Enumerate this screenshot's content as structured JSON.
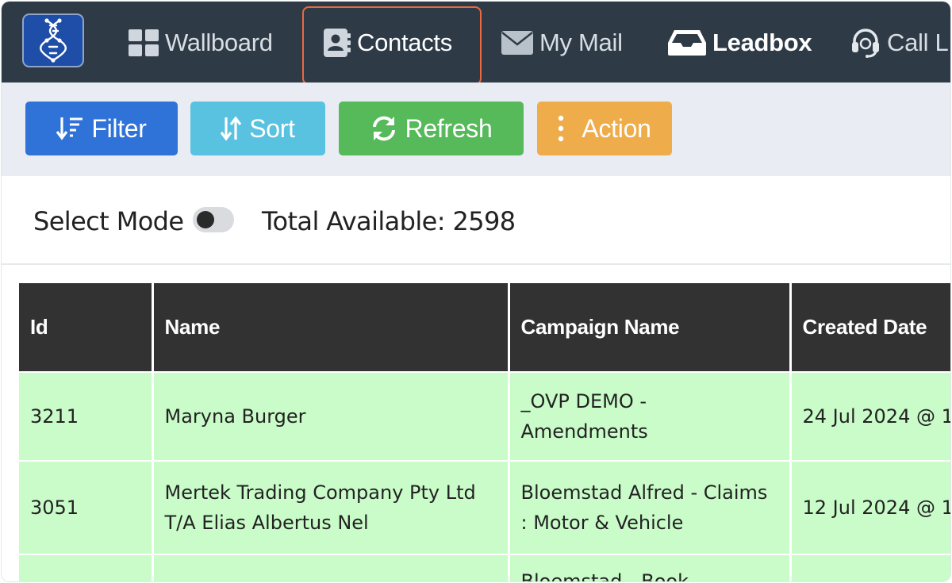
{
  "navbar": {
    "logo_icon": "dna-helix-icon",
    "items": [
      {
        "label": "Wallboard",
        "icon": "grid-icon"
      },
      {
        "label": "Contacts",
        "icon": "contact-book-icon",
        "active": true
      },
      {
        "label": "My Mail",
        "icon": "envelope-icon"
      },
      {
        "label": "Leadbox",
        "icon": "inbox-tray-icon"
      },
      {
        "label": "Call L",
        "icon": "headset-icon"
      }
    ]
  },
  "toolbar": {
    "filter_label": "Filter",
    "sort_label": "Sort",
    "refresh_label": "Refresh",
    "action_label": "Action",
    "colors": {
      "filter": "#2f72d8",
      "sort": "#58c2e0",
      "refresh": "#56b95a",
      "action": "#efac4a"
    }
  },
  "select_mode": {
    "label": "Select Mode",
    "enabled": false,
    "total_label": "Total Available: ",
    "total_value": "2598"
  },
  "table": {
    "columns": [
      "Id",
      "Name",
      "Campaign Name",
      "Created Date"
    ],
    "rows": [
      {
        "id": "3211",
        "name_lines": [
          "Maryna Burger"
        ],
        "campaign_lines": [
          "_OVP DEMO -",
          "Amendments"
        ],
        "created": "24 Jul 2024 @ 1"
      },
      {
        "id": "3051",
        "name_lines": [
          "Mertek Trading Company Pty Ltd",
          "T/A Elias Albertus Nel"
        ],
        "campaign_lines": [
          "Bloemstad Alfred - Claims",
          ": Motor & Vehicle"
        ],
        "created": "12 Jul 2024 @ 1"
      },
      {
        "id": "",
        "name_lines": [
          ""
        ],
        "campaign_lines": [
          "Bloemstad - Book"
        ],
        "created": ""
      }
    ],
    "row_color": "#c9fcc9",
    "header_color": "#323232"
  },
  "highlight_color": "#e86a3e"
}
